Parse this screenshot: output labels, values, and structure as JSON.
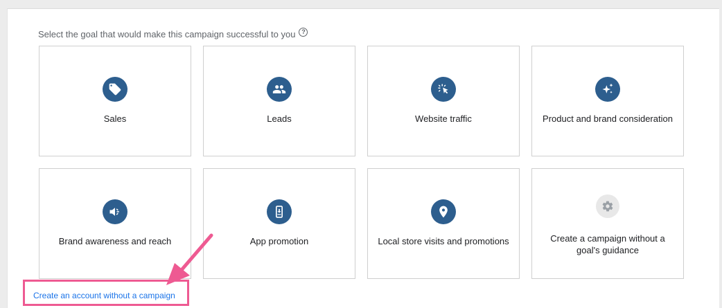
{
  "prompt": {
    "text": "Select the goal that would make this campaign successful to you",
    "help_icon": "?"
  },
  "goals": [
    {
      "label": "Sales",
      "icon": "tag-icon"
    },
    {
      "label": "Leads",
      "icon": "people-icon"
    },
    {
      "label": "Website traffic",
      "icon": "cursor-click-icon"
    },
    {
      "label": "Product and brand consideration",
      "icon": "sparkle-icon"
    },
    {
      "label": "Brand awareness and reach",
      "icon": "megaphone-icon"
    },
    {
      "label": "App promotion",
      "icon": "phone-download-icon"
    },
    {
      "label": "Local store visits and promotions",
      "icon": "location-pin-icon"
    },
    {
      "label": "Create a campaign without a goal's guidance",
      "icon": "gear-icon"
    }
  ],
  "footer": {
    "link_text": "Create an account without a campaign"
  },
  "colors": {
    "icon_bg": "#2d5e8e",
    "highlight": "#ee5a92",
    "link": "#1a73e8"
  }
}
